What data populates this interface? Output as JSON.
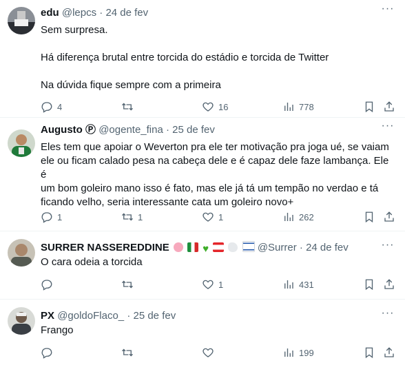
{
  "tweets": [
    {
      "name": "edu",
      "handle": "@lepcs",
      "sep": "·",
      "date": "24 de fev",
      "lines": [
        "Sem surpresa.",
        "",
        "Há diferença brutal entre torcida do estádio e torcida de Twitter",
        "",
        "Na dúvida fique sempre com a primeira"
      ],
      "reply_count": "4",
      "retweet_count": "",
      "like_count": "16",
      "view_count": "778"
    },
    {
      "name": "Augusto",
      "badge": "Ⓟ",
      "handle": "@ogente_fina",
      "sep": "·",
      "date": "25 de fev",
      "lines": [
        "Eles tem que apoiar o Weverton pra ele ter motivação pra joga ué, se vaiam",
        "ele ou ficam calado pesa na cabeça dele e é capaz dele faze lambança. Ele é",
        "um bom goleiro mano isso é fato, mas ele já tá um tempão no verdao e tá",
        "ficando velho, seria interessante cata um goleiro novo+"
      ],
      "reply_count": "1",
      "retweet_count": "1",
      "like_count": "1",
      "view_count": "262"
    },
    {
      "name": "SURRER NASSEREDDINE",
      "emoji_icons": [
        "pig-face-emoji",
        "italy-flag-emoji",
        "green-heart-emoji",
        "lebanon-flag-emoji",
        "dove-emoji",
        "israel-flag-emoji"
      ],
      "handle": "@Surrer",
      "sep": "·",
      "date": "24 de fev",
      "lines": [
        "O cara odeia a torcida"
      ],
      "reply_count": "",
      "retweet_count": "",
      "like_count": "1",
      "view_count": "431"
    },
    {
      "name": "PX",
      "handle": "@goldoFlaco_",
      "sep": "·",
      "date": "25 de fev",
      "lines": [
        "Frango"
      ],
      "reply_count": "",
      "retweet_count": "",
      "like_count": "",
      "view_count": "199"
    }
  ],
  "colors": {
    "text": "#0f1419",
    "muted": "#536471",
    "border": "#eff3f4"
  }
}
